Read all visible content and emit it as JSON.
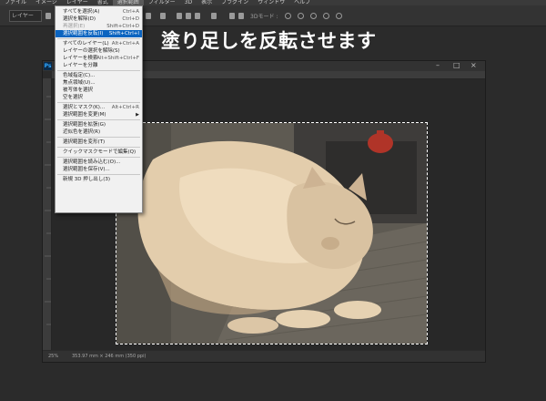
{
  "menubar": {
    "items": [
      "ファイル",
      "イメージ",
      "レイヤー",
      "書式",
      "選択範囲",
      "フィルター",
      "3D",
      "表示",
      "プラグイン",
      "ウィンドウ",
      "ヘルプ"
    ],
    "active_index": 4
  },
  "optionsbar": {
    "layer_select": "レイヤー",
    "mode_3d": "3Dモード :"
  },
  "caption": "塗り足しを反転させます",
  "document": {
    "zoom": "25%",
    "doc_info": "353.97 mm × 246 mm (350 ppi)",
    "window_controls": {
      "minimize": "–",
      "maximize": "□",
      "close": "×"
    },
    "logo_text": "Ps"
  },
  "select_menu": {
    "rows": [
      {
        "label": "すべてを選択(A)",
        "shortcut": "Ctrl+A",
        "disabled": false,
        "highlight": false
      },
      {
        "label": "選択を解除(D)",
        "shortcut": "Ctrl+D",
        "disabled": false,
        "highlight": false
      },
      {
        "label": "再選択(E)",
        "shortcut": "Shift+Ctrl+D",
        "disabled": true,
        "highlight": false
      },
      {
        "label": "選択範囲を反転(I)",
        "shortcut": "Shift+Ctrl+I",
        "disabled": false,
        "highlight": true
      },
      {
        "separator": true
      },
      {
        "label": "すべてのレイヤー(L)",
        "shortcut": "Alt+Ctrl+A",
        "disabled": false,
        "highlight": false
      },
      {
        "label": "レイヤーの選択を解除(S)",
        "shortcut": "",
        "disabled": false,
        "highlight": false
      },
      {
        "label": "レイヤーを検索",
        "shortcut": "Alt+Shift+Ctrl+F",
        "disabled": false,
        "highlight": false
      },
      {
        "label": "レイヤーを分離",
        "shortcut": "",
        "disabled": false,
        "highlight": false
      },
      {
        "separator": true
      },
      {
        "label": "色域指定(C)...",
        "shortcut": "",
        "disabled": false,
        "highlight": false
      },
      {
        "label": "焦点領域(U)...",
        "shortcut": "",
        "disabled": false,
        "highlight": false
      },
      {
        "label": "被写体を選択",
        "shortcut": "",
        "disabled": false,
        "highlight": false
      },
      {
        "label": "空を選択",
        "shortcut": "",
        "disabled": false,
        "highlight": false
      },
      {
        "separator": true
      },
      {
        "label": "選択とマスク(K)...",
        "shortcut": "Alt+Ctrl+R",
        "disabled": false,
        "highlight": false
      },
      {
        "label": "選択範囲を変更(M)",
        "shortcut": "",
        "disabled": false,
        "highlight": false,
        "submenu": true
      },
      {
        "separator": true
      },
      {
        "label": "選択範囲を拡張(G)",
        "shortcut": "",
        "disabled": false,
        "highlight": false
      },
      {
        "label": "近似色を選択(R)",
        "shortcut": "",
        "disabled": false,
        "highlight": false
      },
      {
        "separator": true
      },
      {
        "label": "選択範囲を変形(T)",
        "shortcut": "",
        "disabled": false,
        "highlight": false
      },
      {
        "separator": true
      },
      {
        "label": "クイックマスクモードで編集(Q)",
        "shortcut": "",
        "disabled": false,
        "highlight": false
      },
      {
        "separator": true
      },
      {
        "label": "選択範囲を読み込む(O)...",
        "shortcut": "",
        "disabled": false,
        "highlight": false
      },
      {
        "label": "選択範囲を保存(V)...",
        "shortcut": "",
        "disabled": false,
        "highlight": false
      },
      {
        "separator": true
      },
      {
        "label": "新規 3D 押し出し(3)",
        "shortcut": "",
        "disabled": false,
        "highlight": false
      }
    ]
  },
  "colors": {
    "highlight": "#0b64c0",
    "marquee": "#ffffff",
    "app_bg": "#2b2b2b"
  }
}
